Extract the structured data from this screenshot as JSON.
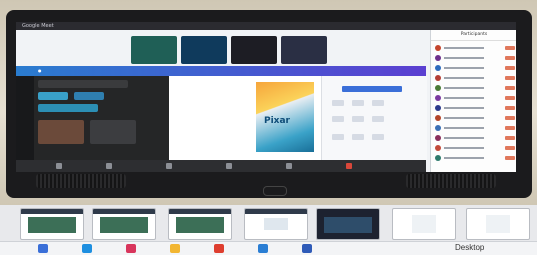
{
  "window": {
    "title": "Google Meet"
  },
  "participants_panel": {
    "title": "Participants",
    "rows": [
      {
        "color": "#c4452d"
      },
      {
        "color": "#6d2f8c"
      },
      {
        "color": "#2e6bbd"
      },
      {
        "color": "#b43e35"
      },
      {
        "color": "#4a7a35"
      },
      {
        "color": "#7b3aa0"
      },
      {
        "color": "#2d3a8c"
      },
      {
        "color": "#b3452a"
      },
      {
        "color": "#3b6fb5"
      },
      {
        "color": "#8a2f5c"
      },
      {
        "color": "#c24a3a"
      },
      {
        "color": "#2e7a6c"
      }
    ]
  },
  "canva": {
    "canvas_word": "Pixar"
  },
  "taskbar": {
    "desktop_label": "Desktop",
    "apps": [
      {
        "icon": "task-view-icon",
        "color": "#3a6fd8"
      },
      {
        "icon": "edge-icon",
        "color": "#1e8fe0"
      },
      {
        "icon": "app-icon",
        "color": "#d8355c"
      },
      {
        "icon": "file-explorer-icon",
        "color": "#f2b632"
      },
      {
        "icon": "chrome-icon",
        "color": "#de3e2f"
      },
      {
        "icon": "store-icon",
        "color": "#2a7ed4"
      },
      {
        "icon": "word-icon",
        "color": "#2f5bb8"
      }
    ]
  },
  "colors": {
    "bezel": "#1b1b1d",
    "canva_gradient_start": "#2a7ccf",
    "canva_gradient_end": "#5b3fd1"
  }
}
